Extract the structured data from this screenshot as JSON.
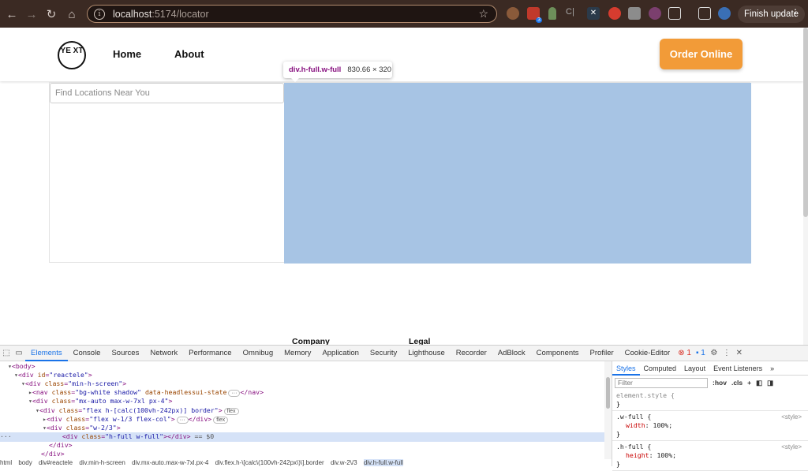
{
  "browser": {
    "url_host": "localhost",
    "url_path": ":5174/locator",
    "extension_badge": "3",
    "update_label": "Finish update"
  },
  "site": {
    "logo_text": "YE XT",
    "nav": [
      "Home",
      "About"
    ],
    "order_button": "Order Online",
    "search_placeholder": "Find Locations Near You",
    "footer": [
      "Company",
      "Legal"
    ]
  },
  "inspect_tooltip": {
    "selector": "div.h-full.w-full",
    "size": "830.66 × 320"
  },
  "devtools": {
    "tabs": [
      "Elements",
      "Console",
      "Sources",
      "Network",
      "Performance",
      "Omnibug",
      "Memory",
      "Application",
      "Security",
      "Lighthouse",
      "Recorder",
      "AdBlock",
      "Components",
      "Profiler",
      "Cookie-Editor"
    ],
    "error_count": "1",
    "message_count": "1",
    "style_tabs": [
      "Styles",
      "Computed",
      "Layout",
      "Event Listeners"
    ],
    "filter_placeholder": "Filter",
    "hov": ":hov",
    "cls": ".cls",
    "breadcrumbs": [
      "html",
      "body",
      "div#reactele",
      "div.min-h-screen",
      "div.mx-auto.max-w-7xl.px-4",
      "div.flex.h-\\[calc\\(100vh-242px\\)\\].border",
      "div.w-2\\/3",
      "div.h-full.w-full"
    ],
    "rules": [
      {
        "selector": "element.style {",
        "source": "",
        "prop": "",
        "value": ""
      },
      {
        "selector": ".w-full {",
        "source": "<style>",
        "prop": "width",
        "value": "100%;"
      },
      {
        "selector": ".h-full {",
        "source": "<style>",
        "prop": "height",
        "value": "100%;"
      }
    ]
  }
}
